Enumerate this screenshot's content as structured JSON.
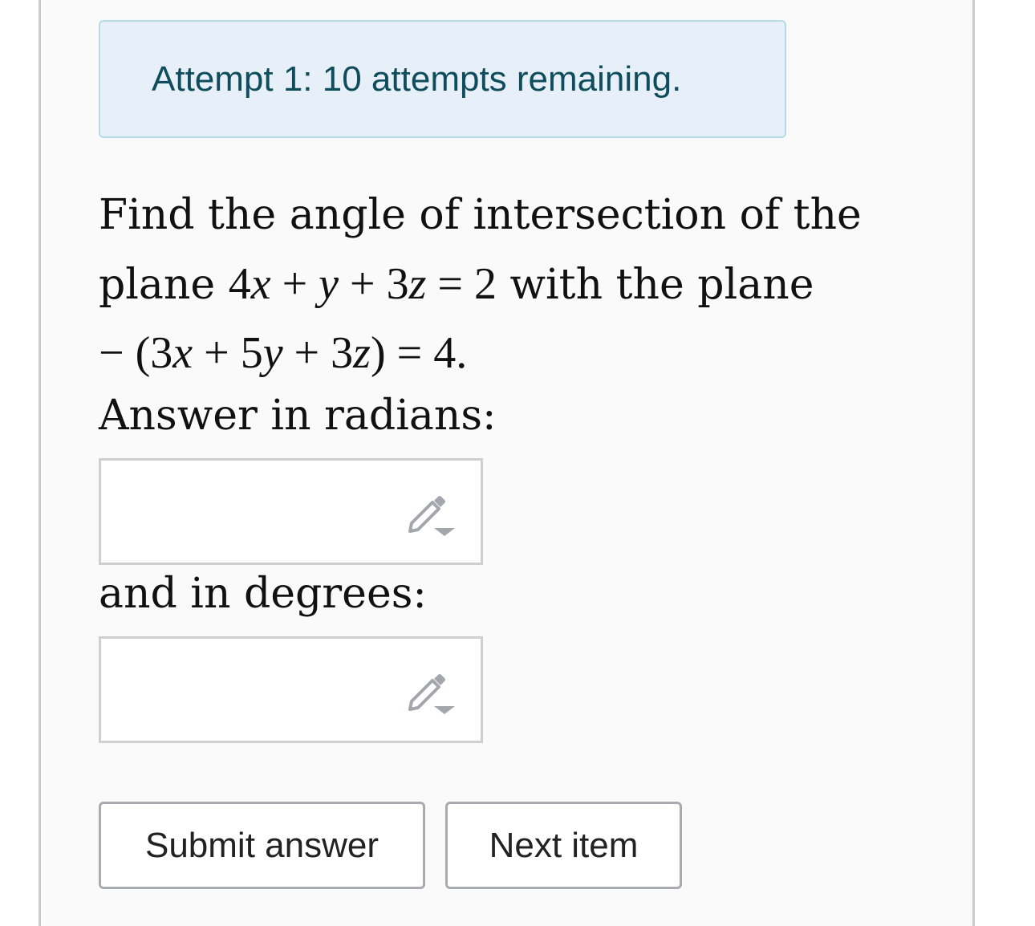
{
  "attempts": {
    "text": "Attempt 1: 10 attempts remaining."
  },
  "question": {
    "line1": "Find the angle of intersection of the",
    "line2_pre": "plane ",
    "plane1": {
      "c1": "4",
      "v1": "x",
      "op1": " + ",
      "v2": "y",
      "op2": " + ",
      "c3": "3",
      "v3": "z",
      "eq": " = ",
      "rhs": "2"
    },
    "line2_post": " with the plane",
    "plane2": {
      "neg": "− (",
      "c1": "3",
      "v1": "x",
      "op1": " + ",
      "c2": "5",
      "v2": "y",
      "op2": " + ",
      "c3": "3",
      "v3": "z",
      "close": ")",
      "eq": " = ",
      "rhs": "4."
    }
  },
  "radians": {
    "label": "Answer in radians:",
    "value": "",
    "icon": "pencil-dropdown-icon"
  },
  "degrees": {
    "label": "and in degrees:",
    "value": "",
    "icon": "pencil-dropdown-icon"
  },
  "buttons": {
    "submit": "Submit answer",
    "next": "Next item"
  },
  "colors": {
    "banner_bg": "#e7f0f8",
    "banner_border": "#b5dce6",
    "banner_text": "#0f4d5c",
    "icon": "#a3a7ad"
  }
}
